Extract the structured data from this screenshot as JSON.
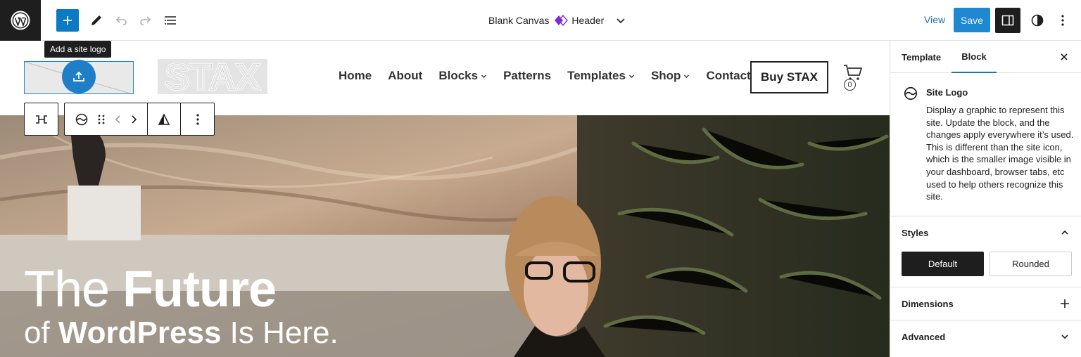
{
  "topbar": {
    "document_title": "Blank Canvas",
    "template_part": "Header",
    "view_label": "View",
    "save_label": "Save"
  },
  "tooltip": "Add a site logo",
  "site": {
    "logo_text": "STAX",
    "nav": [
      {
        "label": "Home",
        "has_submenu": false
      },
      {
        "label": "About",
        "has_submenu": false
      },
      {
        "label": "Blocks",
        "has_submenu": true
      },
      {
        "label": "Patterns",
        "has_submenu": false
      },
      {
        "label": "Templates",
        "has_submenu": true
      },
      {
        "label": "Shop",
        "has_submenu": true
      },
      {
        "label": "Contact",
        "has_submenu": false
      }
    ],
    "buy_button": "Buy STAX",
    "cart_count": "0"
  },
  "hero": {
    "title_plain": "The ",
    "title_bold": "Future",
    "sub_plain_1": "of ",
    "sub_bold": "WordPress",
    "sub_plain_2": " Is Here."
  },
  "sidebar": {
    "tabs": [
      "Template",
      "Block"
    ],
    "active_tab": "Block",
    "block_title": "Site Logo",
    "block_description": "Display a graphic to represent this site. Update the block, and the changes apply everywhere it’s used. This is different than the site icon, which is the smaller image visible in your dashboard, browser tabs, etc used to help others recognize this site.",
    "styles_label": "Styles",
    "style_options": [
      "Default",
      "Rounded"
    ],
    "selected_style": "Default",
    "dimensions_label": "Dimensions",
    "advanced_label": "Advanced"
  },
  "colors": {
    "accent": "#2271b1",
    "primary_button": "#1e88d0",
    "dark": "#1e1e1e"
  }
}
